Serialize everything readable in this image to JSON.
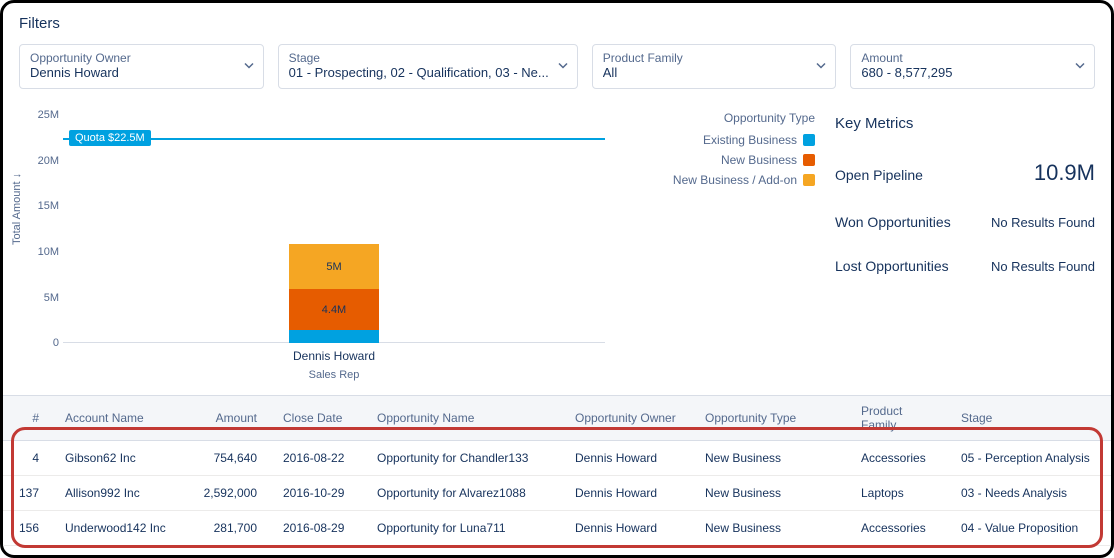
{
  "title": "Filters",
  "filters": [
    {
      "label": "Opportunity Owner",
      "value": "Dennis Howard"
    },
    {
      "label": "Stage",
      "value": "01 - Prospecting, 02 - Qualification, 03 - Ne..."
    },
    {
      "label": "Product Family",
      "value": "All"
    },
    {
      "label": "Amount",
      "value": "680 - 8,577,295"
    }
  ],
  "legend": {
    "title": "Opportunity Type",
    "items": [
      {
        "label": "Existing Business",
        "color": "#00a1e0"
      },
      {
        "label": "New Business",
        "color": "#e65c00"
      },
      {
        "label": "New Business / Add-on",
        "color": "#f5a623"
      }
    ]
  },
  "chart_data": {
    "type": "bar",
    "title": "",
    "xlabel": "Sales Rep",
    "ylabel": "Total Amount",
    "ylim": [
      0,
      25
    ],
    "yunit": "M",
    "yticks": [
      "0",
      "5M",
      "10M",
      "15M",
      "20M",
      "25M"
    ],
    "categories": [
      "Dennis Howard"
    ],
    "series": [
      {
        "name": "Existing Business",
        "values": [
          1.5
        ],
        "color": "#00a1e0",
        "label": ""
      },
      {
        "name": "New Business",
        "values": [
          4.4
        ],
        "color": "#e65c00",
        "label": "4.4M"
      },
      {
        "name": "New Business / Add-on",
        "values": [
          5.0
        ],
        "color": "#f5a623",
        "label": "5M"
      }
    ],
    "quota": {
      "label": "Quota $22.5M",
      "value": 22.5
    }
  },
  "metrics": {
    "title": "Key Metrics",
    "rows": [
      {
        "label": "Open Pipeline",
        "value": "10.9M",
        "big": true
      },
      {
        "label": "Won Opportunities",
        "value": "No Results Found",
        "big": false
      },
      {
        "label": "Lost Opportunities",
        "value": "No Results Found",
        "big": false
      }
    ]
  },
  "table": {
    "headers": [
      "#",
      "Account Name",
      "Amount",
      "Close Date",
      "Opportunity Name",
      "Opportunity Owner",
      "Opportunity Type",
      "Product Family",
      "Stage"
    ],
    "rows": [
      {
        "n": "4",
        "account": "Gibson62 Inc",
        "amount": "754,640",
        "close": "2016-08-22",
        "opp": "Opportunity for Chandler133",
        "owner": "Dennis Howard",
        "type": "New Business",
        "family": "Accessories",
        "stage": "05 - Perception Analysis"
      },
      {
        "n": "137",
        "account": "Allison992 Inc",
        "amount": "2,592,000",
        "close": "2016-10-29",
        "opp": "Opportunity for Alvarez1088",
        "owner": "Dennis Howard",
        "type": "New Business",
        "family": "Laptops",
        "stage": "03 - Needs Analysis"
      },
      {
        "n": "156",
        "account": "Underwood142 Inc",
        "amount": "281,700",
        "close": "2016-08-29",
        "opp": "Opportunity for Luna711",
        "owner": "Dennis Howard",
        "type": "New Business",
        "family": "Accessories",
        "stage": "04 - Value Proposition"
      }
    ]
  }
}
